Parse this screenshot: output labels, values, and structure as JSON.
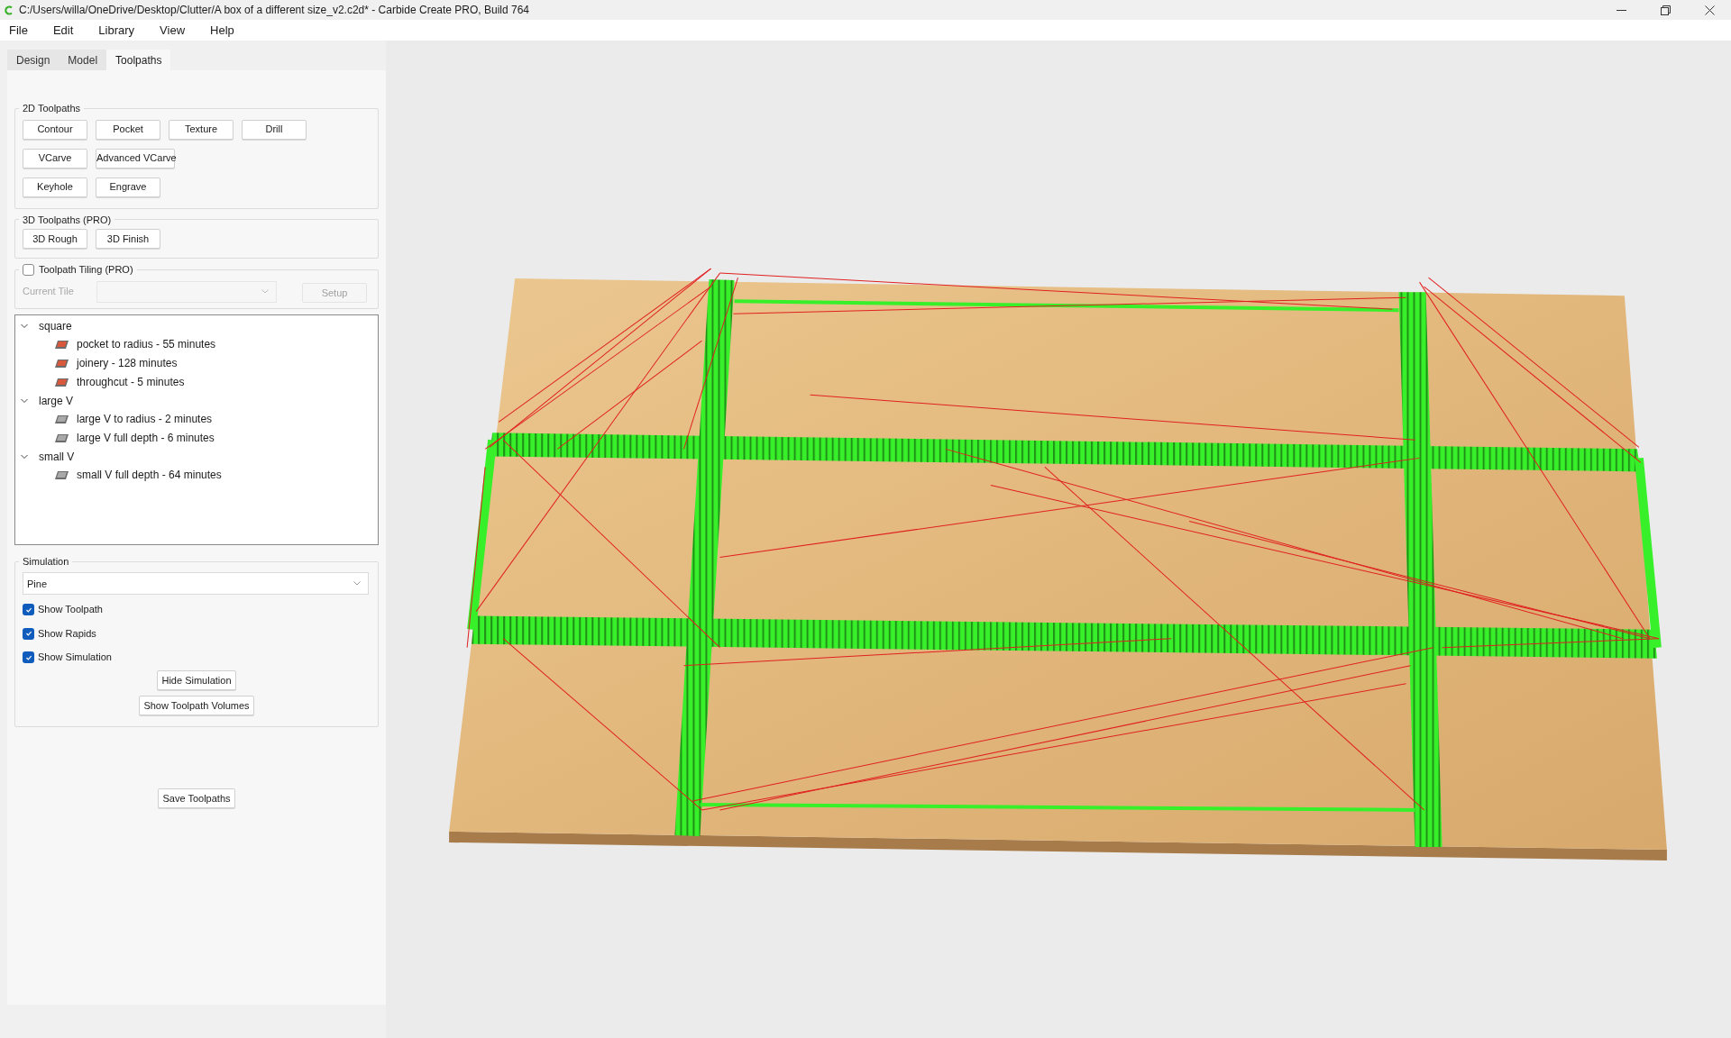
{
  "window": {
    "title": "C:/Users/willa/OneDrive/Desktop/Clutter/A box of a different size_v2.c2d* - Carbide Create PRO, Build 764"
  },
  "menu": [
    "File",
    "Edit",
    "Library",
    "View",
    "Help"
  ],
  "tabs": [
    {
      "label": "Design",
      "selected": false
    },
    {
      "label": "Model",
      "selected": false
    },
    {
      "label": "Toolpaths",
      "selected": true
    }
  ],
  "toolpaths_2d": {
    "title": "2D Toolpaths",
    "rows": [
      [
        "Contour",
        "Pocket",
        "Texture",
        "Drill"
      ],
      [
        "VCarve",
        "Advanced VCarve"
      ],
      [
        "Keyhole",
        "Engrave"
      ]
    ]
  },
  "toolpaths_3d": {
    "title": "3D Toolpaths (PRO)",
    "buttons": [
      "3D Rough",
      "3D Finish"
    ]
  },
  "tiling": {
    "label": "Toolpath Tiling (PRO)",
    "checked": false,
    "current_tile_label": "Current Tile",
    "setup_button": "Setup",
    "disabled": true
  },
  "tree": [
    {
      "label": "square",
      "expanded": true,
      "children": [
        {
          "label": "pocket to radius - 55 minutes",
          "color": "#d9573b"
        },
        {
          "label": "joinery - 128 minutes",
          "color": "#d9573b"
        },
        {
          "label": "throughcut - 5 minutes",
          "color": "#d9573b"
        }
      ]
    },
    {
      "label": "large V",
      "expanded": true,
      "children": [
        {
          "label": "large V to radius - 2 minutes",
          "color": "#a8a8a8"
        },
        {
          "label": "large V full depth - 6 minutes",
          "color": "#a8a8a8"
        }
      ]
    },
    {
      "label": "small V",
      "expanded": true,
      "children": [
        {
          "label": "small V full depth - 64 minutes",
          "color": "#a8a8a8"
        }
      ]
    }
  ],
  "simulation": {
    "title": "Simulation",
    "material": "Pine",
    "checkboxes": [
      {
        "label": "Show Toolpath",
        "checked": true
      },
      {
        "label": "Show Rapids",
        "checked": true
      },
      {
        "label": "Show Simulation",
        "checked": true
      }
    ],
    "buttons": [
      "Hide Simulation",
      "Show Toolpath Volumes"
    ]
  },
  "save_button": "Save Toolpaths"
}
